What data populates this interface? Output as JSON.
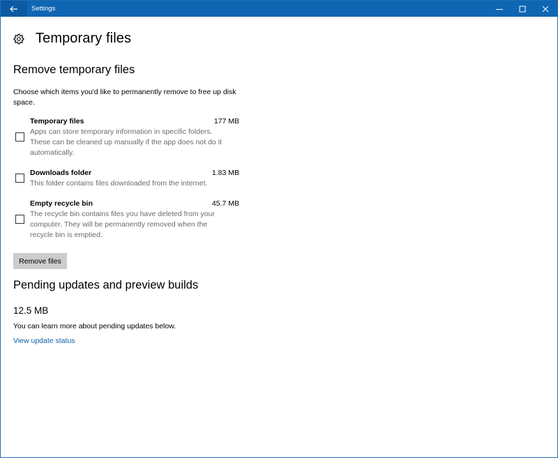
{
  "window": {
    "title": "Settings"
  },
  "page": {
    "title": "Temporary files"
  },
  "remove_section": {
    "title": "Remove temporary files",
    "description": "Choose which items you'd like to permanently remove to free up disk space.",
    "items": [
      {
        "name": "Temporary files",
        "size": "177 MB",
        "desc_lines": [
          "Apps can store temporary information in specific folders.",
          "These can be cleaned up manually if the app does not do it",
          "automatically."
        ]
      },
      {
        "name": "Downloads folder",
        "size": "1.83 MB",
        "desc_lines": [
          "This folder contains files downloaded from the internet."
        ]
      },
      {
        "name": "Empty recycle bin",
        "size": "45.7 MB",
        "desc_lines": [
          "The recycle bin contains files you have deleted from your",
          "computer. They will be permanently removed when the",
          "recycle bin is emptied."
        ]
      }
    ],
    "button_label": "Remove files"
  },
  "pending_section": {
    "title": "Pending updates and preview builds",
    "size": "12.5 MB",
    "info": "You can learn more about pending updates below.",
    "link": "View update status"
  },
  "colors": {
    "titlebar": "#0f66b3",
    "link": "#0a5fa8",
    "button": "#cccccc"
  }
}
